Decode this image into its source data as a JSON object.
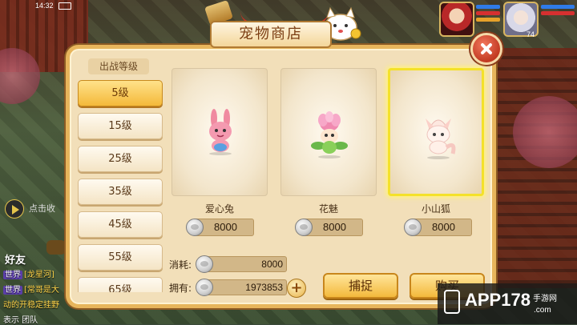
{
  "status_bar": {
    "time": "14:32"
  },
  "player": {
    "level": "74"
  },
  "chat": {
    "click_collect": "点击收",
    "friends_label": "好友",
    "lines": [
      {
        "tag": "世界",
        "text": "[龙星河]"
      },
      {
        "tag": "世界",
        "text": "[常哥是大"
      },
      {
        "tag": "",
        "text": "动的开稳定挂野"
      },
      {
        "tag": "",
        "text": "表示 团队"
      }
    ]
  },
  "shop": {
    "title": "宠物商店",
    "level_header": "出战等级",
    "levels": [
      {
        "label": "5级",
        "active": true
      },
      {
        "label": "15级",
        "active": false
      },
      {
        "label": "25级",
        "active": false
      },
      {
        "label": "35级",
        "active": false
      },
      {
        "label": "45级",
        "active": false
      },
      {
        "label": "55级",
        "active": false
      },
      {
        "label": "65级",
        "active": false
      }
    ],
    "pets": [
      {
        "name": "爱心兔",
        "price": "8000",
        "selected": false,
        "icon": "pink-rabbit-pet"
      },
      {
        "name": "花魅",
        "price": "8000",
        "selected": false,
        "icon": "flower-sprite-pet"
      },
      {
        "name": "小山狐",
        "price": "8000",
        "selected": true,
        "icon": "mountain-fox-pet"
      }
    ],
    "cost_label": "消耗:",
    "cost_value": "8000",
    "own_label": "拥有:",
    "own_value": "1973853",
    "plus_label": "+",
    "catch_button": "捕捉",
    "buy_button": "购买"
  },
  "watermark": {
    "text": "APP178",
    "sub": "手游网",
    "url": ".com"
  },
  "colors": {
    "panel_bg": "#f2dfb9",
    "panel_border": "#e7b55c",
    "button_gold": "#f3b93c",
    "selected_glow": "#f4e12a",
    "close_red": "#c23a22"
  }
}
